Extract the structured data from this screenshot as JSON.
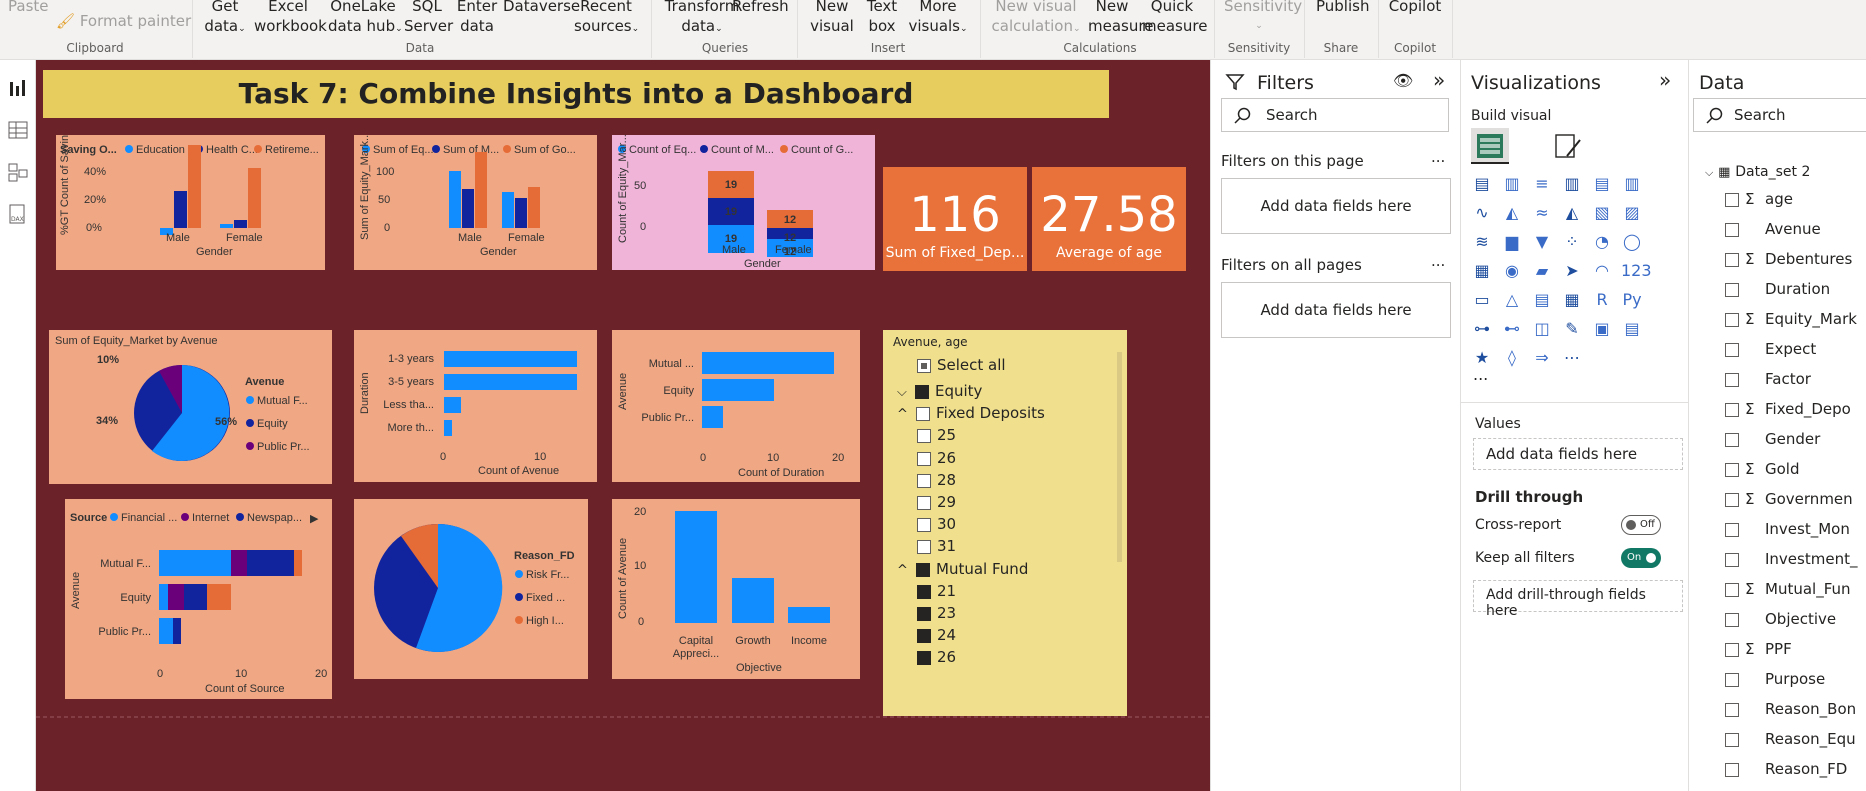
{
  "ribbon": {
    "paste": "Paste",
    "format_painter": "Format painter",
    "clipboard": "Clipboard",
    "get_data": [
      "Get",
      "data"
    ],
    "excel": [
      "Excel",
      "workbook"
    ],
    "onelake": [
      "OneLake",
      "data hub"
    ],
    "sql": [
      "SQL",
      "Server"
    ],
    "enter": [
      "Enter",
      "data"
    ],
    "dataverse": "Dataverse",
    "recent": [
      "Recent",
      "sources"
    ],
    "data_grp": "Data",
    "transform": [
      "Transform",
      "data"
    ],
    "refresh": "Refresh",
    "queries": "Queries",
    "new_visual": [
      "New",
      "visual"
    ],
    "text_box": [
      "Text",
      "box"
    ],
    "more_visuals": [
      "More",
      "visuals"
    ],
    "insert": "Insert",
    "new_visual_calc": [
      "New visual",
      "calculation"
    ],
    "new_measure": [
      "New",
      "measure"
    ],
    "quick_measure": [
      "Quick",
      "measure"
    ],
    "calculations": "Calculations",
    "sensitivity": "Sensitivity",
    "sensitivity_grp": "Sensitivity",
    "publish": "Publish",
    "share": "Share",
    "copilot": "Copilot",
    "copilot_grp": "Copilot"
  },
  "title": "Task 7: Combine Insights into a Dashboard",
  "cards": [
    {
      "value": "116",
      "label": "Sum of Fixed_Dep..."
    },
    {
      "value": "27.58",
      "label": "Average of age"
    }
  ],
  "charts": {
    "c1": {
      "legend": [
        "Saving O...",
        "Education",
        "Health C...",
        "Retireme..."
      ],
      "ylabel": "%GT Count of Saving...",
      "xlabel": "Gender",
      "ticks": [
        "40%",
        "20%",
        "0%"
      ],
      "cats": [
        "Male",
        "Female"
      ]
    },
    "c2": {
      "legend": [
        "Sum of Eq...",
        "Sum of M...",
        "Sum of Go..."
      ],
      "ylabel": "Sum of Equity_Mark...",
      "xlabel": "Gender",
      "ticks": [
        "100",
        "50",
        "0"
      ],
      "cats": [
        "Male",
        "Female"
      ]
    },
    "c3": {
      "legend": [
        "Count of Eq...",
        "Count of M...",
        "Count of G..."
      ],
      "ylabel": "Count of Equity_Mar...",
      "xlabel": "Gender",
      "ticks": [
        "50",
        "0"
      ],
      "cats": [
        "Male",
        "Female"
      ],
      "male": [
        "19",
        "19",
        "19"
      ],
      "female": [
        "12",
        "12",
        "12"
      ]
    },
    "c4": {
      "title": "Sum of Equity_Market by Avenue",
      "legend_title": "Avenue",
      "legend": [
        "Mutual F...",
        "Equity",
        "Public Pr..."
      ],
      "labels": [
        "10%",
        "34%",
        "56%"
      ]
    },
    "c5": {
      "ylabel": "Duration",
      "xlabel": "Count of Avenue",
      "cats": [
        "1-3 years",
        "3-5 years",
        "Less tha...",
        "More th..."
      ],
      "ticks": [
        "0",
        "10"
      ]
    },
    "c6": {
      "ylabel": "Avenue",
      "xlabel": "Count of Duration",
      "cats": [
        "Mutual ...",
        "Equity",
        "Public Pr..."
      ],
      "ticks": [
        "0",
        "10",
        "20"
      ]
    },
    "c7": {
      "legend": [
        "Source",
        "Financial ...",
        "Internet",
        "Newspap..."
      ],
      "ylabel": "Avenue",
      "xlabel": "Count of Source",
      "cats": [
        "Mutual F...",
        "Equity",
        "Public Pr..."
      ],
      "ticks": [
        "0",
        "10",
        "20"
      ]
    },
    "c8": {
      "legend_title": "Reason_FD",
      "legend": [
        "Risk Fr...",
        "Fixed ...",
        "High I..."
      ]
    },
    "c9": {
      "ylabel": "Count of Avenue",
      "xlabel": "Objective",
      "cats": [
        "Capital",
        "Growth",
        "Income"
      ],
      "cat1b": "Appreci...",
      "ticks": [
        "20",
        "10",
        "0"
      ]
    }
  },
  "slicer": {
    "header": "Avenue, age",
    "select_all": "Select all",
    "items": [
      {
        "label": "Equity",
        "level": 0,
        "check": "fill",
        "exp": "v"
      },
      {
        "label": "Fixed Deposits",
        "level": 0,
        "check": "empty",
        "exp": "^"
      },
      {
        "label": "25",
        "level": 1,
        "check": "empty"
      },
      {
        "label": "26",
        "level": 1,
        "check": "empty"
      },
      {
        "label": "28",
        "level": 1,
        "check": "empty"
      },
      {
        "label": "29",
        "level": 1,
        "check": "empty"
      },
      {
        "label": "30",
        "level": 1,
        "check": "empty"
      },
      {
        "label": "31",
        "level": 1,
        "check": "empty"
      },
      {
        "label": "Mutual Fund",
        "level": 0,
        "check": "fill",
        "exp": "^"
      },
      {
        "label": "21",
        "level": 1,
        "check": "fill"
      },
      {
        "label": "23",
        "level": 1,
        "check": "fill"
      },
      {
        "label": "24",
        "level": 1,
        "check": "fill"
      },
      {
        "label": "26",
        "level": 1,
        "check": "fill"
      }
    ]
  },
  "filters": {
    "title": "Filters",
    "search": "Search",
    "on_page": "Filters on this page",
    "on_all": "Filters on all pages",
    "add": "Add data fields here",
    "more": "..."
  },
  "viz": {
    "title": "Visualizations",
    "build": "Build visual",
    "values": "Values",
    "add": "Add data fields here",
    "drill": "Drill through",
    "cross": "Cross-report",
    "cross_state": "Off",
    "keep": "Keep all filters",
    "keep_state": "On",
    "add_drill": "Add drill-through fields here",
    "more": "..."
  },
  "data": {
    "title": "Data",
    "search": "Search",
    "table": "Data_set 2",
    "fields": [
      {
        "name": "age",
        "sigma": true
      },
      {
        "name": "Avenue",
        "sigma": false
      },
      {
        "name": "Debentures",
        "sigma": true
      },
      {
        "name": "Duration",
        "sigma": false
      },
      {
        "name": "Equity_Mark",
        "sigma": true
      },
      {
        "name": "Expect",
        "sigma": false
      },
      {
        "name": "Factor",
        "sigma": false
      },
      {
        "name": "Fixed_Depo",
        "sigma": true
      },
      {
        "name": "Gender",
        "sigma": false
      },
      {
        "name": "Gold",
        "sigma": true
      },
      {
        "name": "Governmen",
        "sigma": true
      },
      {
        "name": "Invest_Mon",
        "sigma": false
      },
      {
        "name": "Investment_",
        "sigma": false
      },
      {
        "name": "Mutual_Fun",
        "sigma": true
      },
      {
        "name": "Objective",
        "sigma": false
      },
      {
        "name": "PPF",
        "sigma": true
      },
      {
        "name": "Purpose",
        "sigma": false
      },
      {
        "name": "Reason_Bon",
        "sigma": false
      },
      {
        "name": "Reason_Equ",
        "sigma": false
      },
      {
        "name": "Reason_FD",
        "sigma": false
      }
    ]
  },
  "colors": {
    "blue": "#118dff",
    "navy": "#12239e",
    "orange": "#e66c37",
    "purple": "#6b007b"
  }
}
